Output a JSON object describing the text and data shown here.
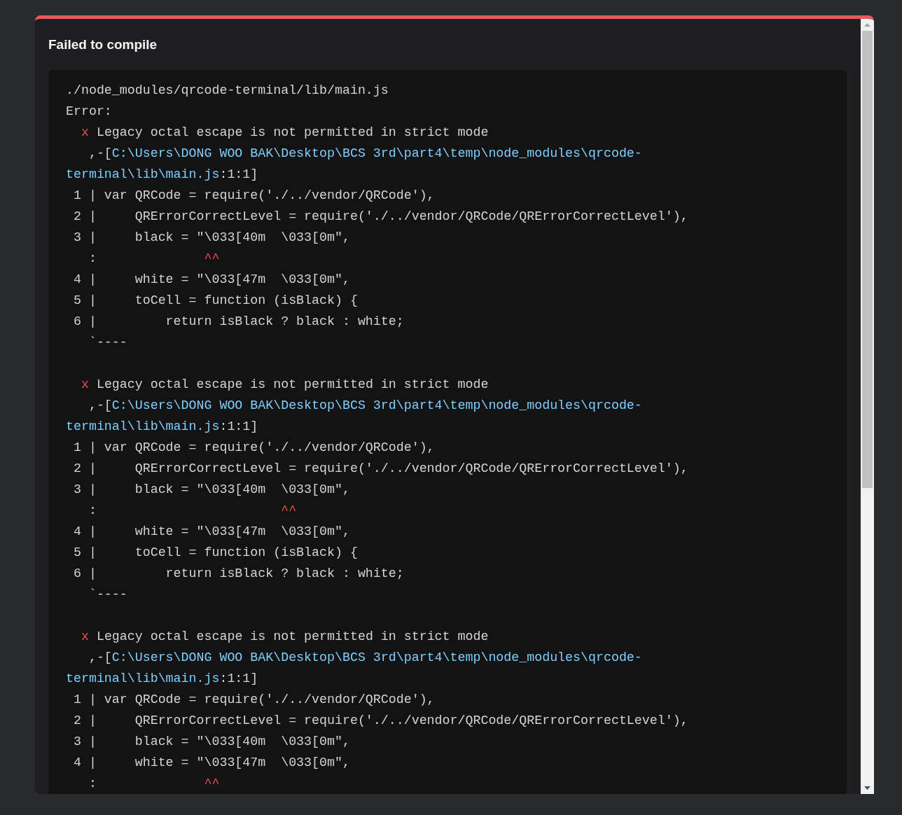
{
  "dialog": {
    "title": "Failed to compile"
  },
  "output": {
    "file": "./node_modules/qrcode-terminal/lib/main.js",
    "label": "Error:",
    "diagnostics": [
      {
        "lines": [
          {
            "kind": "message",
            "mark": "x",
            "text": "Legacy octal escape is not permitted in strict mode"
          },
          {
            "kind": "location",
            "bracket": ",-[",
            "path": "C:\\Users\\DONG WOO BAK\\Desktop\\BCS 3rd\\part4\\temp\\node_modules\\qrcode-"
          },
          {
            "kind": "location_tail",
            "path": "terminal\\lib\\main.js",
            "suffix": ":1:1]"
          },
          {
            "kind": "source",
            "text": "1 | var QRCode = require('./../vendor/QRCode'),"
          },
          {
            "kind": "source",
            "text": "2 |     QRErrorCorrectLevel = require('./../vendor/QRCode/QRErrorCorrectLevel'),"
          },
          {
            "kind": "source",
            "text": "3 |     black = \"\\033[40m  \\033[0m\","
          },
          {
            "kind": "caret",
            "gutter": ":",
            "marker": "              ^^"
          },
          {
            "kind": "source",
            "text": "4 |     white = \"\\033[47m  \\033[0m\","
          },
          {
            "kind": "source",
            "text": "5 |     toCell = function (isBlack) {"
          },
          {
            "kind": "source",
            "text": "6 |         return isBlack ? black : white;"
          },
          {
            "kind": "end",
            "text": "`----"
          }
        ]
      },
      {
        "lines": [
          {
            "kind": "message",
            "mark": "x",
            "text": "Legacy octal escape is not permitted in strict mode"
          },
          {
            "kind": "location",
            "bracket": ",-[",
            "path": "C:\\Users\\DONG WOO BAK\\Desktop\\BCS 3rd\\part4\\temp\\node_modules\\qrcode-"
          },
          {
            "kind": "location_tail",
            "path": "terminal\\lib\\main.js",
            "suffix": ":1:1]"
          },
          {
            "kind": "source",
            "text": "1 | var QRCode = require('./../vendor/QRCode'),"
          },
          {
            "kind": "source",
            "text": "2 |     QRErrorCorrectLevel = require('./../vendor/QRCode/QRErrorCorrectLevel'),"
          },
          {
            "kind": "source",
            "text": "3 |     black = \"\\033[40m  \\033[0m\","
          },
          {
            "kind": "caret",
            "gutter": ":",
            "marker": "                        ^^"
          },
          {
            "kind": "source",
            "text": "4 |     white = \"\\033[47m  \\033[0m\","
          },
          {
            "kind": "source",
            "text": "5 |     toCell = function (isBlack) {"
          },
          {
            "kind": "source",
            "text": "6 |         return isBlack ? black : white;"
          },
          {
            "kind": "end",
            "text": "`----"
          }
        ]
      },
      {
        "lines": [
          {
            "kind": "message",
            "mark": "x",
            "text": "Legacy octal escape is not permitted in strict mode"
          },
          {
            "kind": "location",
            "bracket": ",-[",
            "path": "C:\\Users\\DONG WOO BAK\\Desktop\\BCS 3rd\\part4\\temp\\node_modules\\qrcode-"
          },
          {
            "kind": "location_tail",
            "path": "terminal\\lib\\main.js",
            "suffix": ":1:1]"
          },
          {
            "kind": "source",
            "text": "1 | var QRCode = require('./../vendor/QRCode'),"
          },
          {
            "kind": "source",
            "text": "2 |     QRErrorCorrectLevel = require('./../vendor/QRCode/QRErrorCorrectLevel'),"
          },
          {
            "kind": "source",
            "text": "3 |     black = \"\\033[40m  \\033[0m\","
          },
          {
            "kind": "source",
            "text": "4 |     white = \"\\033[47m  \\033[0m\","
          },
          {
            "kind": "caret",
            "gutter": ":",
            "marker": "              ^^"
          }
        ]
      }
    ]
  }
}
